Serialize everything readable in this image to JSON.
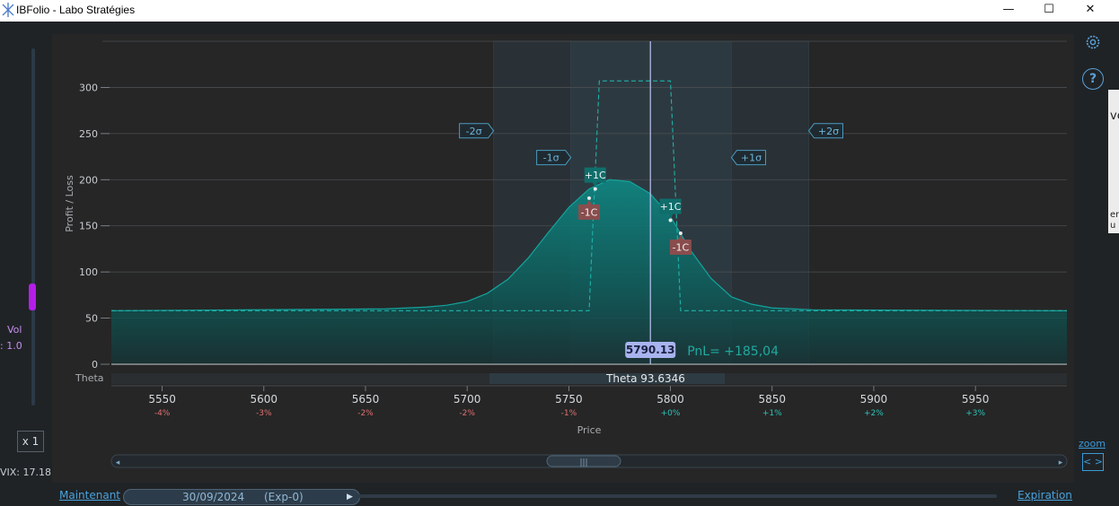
{
  "window": {
    "title": "IBFolio - Labo Stratégies",
    "minimize_glyph": "—",
    "maximize_glyph": "☐",
    "close_glyph": "✕"
  },
  "left_panel": {
    "vol_label": "Vol",
    "vol_value": ": 1.0",
    "vol_level": 0.22,
    "multiplier_label": "x 1",
    "vix_label": "VIX: 17.18"
  },
  "right_panel": {
    "settings_icon": "gear-icon",
    "help_label": "?",
    "zoom_label": "zoom",
    "zoom_button_label": "< >",
    "edge_fragments": [
      "ve",
      "en",
      "u"
    ]
  },
  "chart_data": {
    "type": "area",
    "ylabel": "Profit / Loss",
    "xlabel": "Price",
    "ylim": [
      0,
      350
    ],
    "xlim": [
      5525,
      5995
    ],
    "y_ticks": [
      0,
      50,
      100,
      150,
      200,
      250,
      300
    ],
    "x_ticks": [
      {
        "value": 5550,
        "pct": "-4%"
      },
      {
        "value": 5600,
        "pct": "-3%"
      },
      {
        "value": 5650,
        "pct": "-2%"
      },
      {
        "value": 5700,
        "pct": "-2%"
      },
      {
        "value": 5750,
        "pct": "-1%"
      },
      {
        "value": 5800,
        "pct": "+0%"
      },
      {
        "value": 5850,
        "pct": "+1%"
      },
      {
        "value": 5900,
        "pct": "+2%"
      },
      {
        "value": 5950,
        "pct": "+3%"
      }
    ],
    "grid": true,
    "series": [
      {
        "style": "filled-area",
        "x": [
          5525,
          5660,
          5680,
          5690,
          5700,
          5710,
          5720,
          5730,
          5740,
          5750,
          5760,
          5770,
          5780,
          5790,
          5800,
          5810,
          5820,
          5830,
          5840,
          5850,
          5870,
          5995
        ],
        "y": [
          58,
          60,
          62,
          64,
          68,
          77,
          92,
          115,
          143,
          170,
          190,
          200,
          198,
          185,
          160,
          123,
          93,
          73,
          65,
          61,
          59,
          58
        ]
      },
      {
        "style": "dashed",
        "x": [
          5525,
          5760,
          5765,
          5800,
          5805,
          5995
        ],
        "y": [
          58,
          58,
          307,
          307,
          58,
          58
        ]
      }
    ],
    "sigma_bands": [
      {
        "label": "-2σ",
        "from": 5713,
        "to": 5868
      },
      {
        "label": "-1σ",
        "from": 5751,
        "to": 5830
      }
    ],
    "sigma_markers": [
      {
        "label": "-2σ",
        "x": 5713,
        "y": 253,
        "side": "left"
      },
      {
        "label": "-1σ",
        "x": 5751,
        "y": 224,
        "side": "left"
      },
      {
        "label": "+1σ",
        "x": 5830,
        "y": 224,
        "side": "right"
      },
      {
        "label": "+2σ",
        "x": 5868,
        "y": 253,
        "side": "right"
      }
    ],
    "legs": [
      {
        "label": "+1C",
        "x": 5763,
        "y": 190,
        "kind": "long"
      },
      {
        "label": "-1C",
        "x": 5760,
        "y": 180,
        "kind": "short"
      },
      {
        "label": "+1C",
        "x": 5800,
        "y": 156,
        "kind": "long"
      },
      {
        "label": "-1C",
        "x": 5805,
        "y": 142,
        "kind": "short"
      }
    ],
    "current_price": 5790.13,
    "current_price_label": "5790.13",
    "pnl_label": "PnL= +185,04",
    "theta_row_label": "Theta",
    "theta_value_label": "Theta 93.6346"
  },
  "timeline": {
    "start_link": "Maintenant",
    "date_label": "30/09/2024",
    "expiry_tag": "(Exp-0)",
    "end_link": "Expiration"
  },
  "colors": {
    "accent_teal": "#0f8a86",
    "sigma_blue": "#4a9ac0",
    "price_badge": "#a8b4ef",
    "long_leg": "#0f6e6b",
    "short_leg": "#8a4d4d",
    "vol_thumb": "#b41ee8"
  }
}
